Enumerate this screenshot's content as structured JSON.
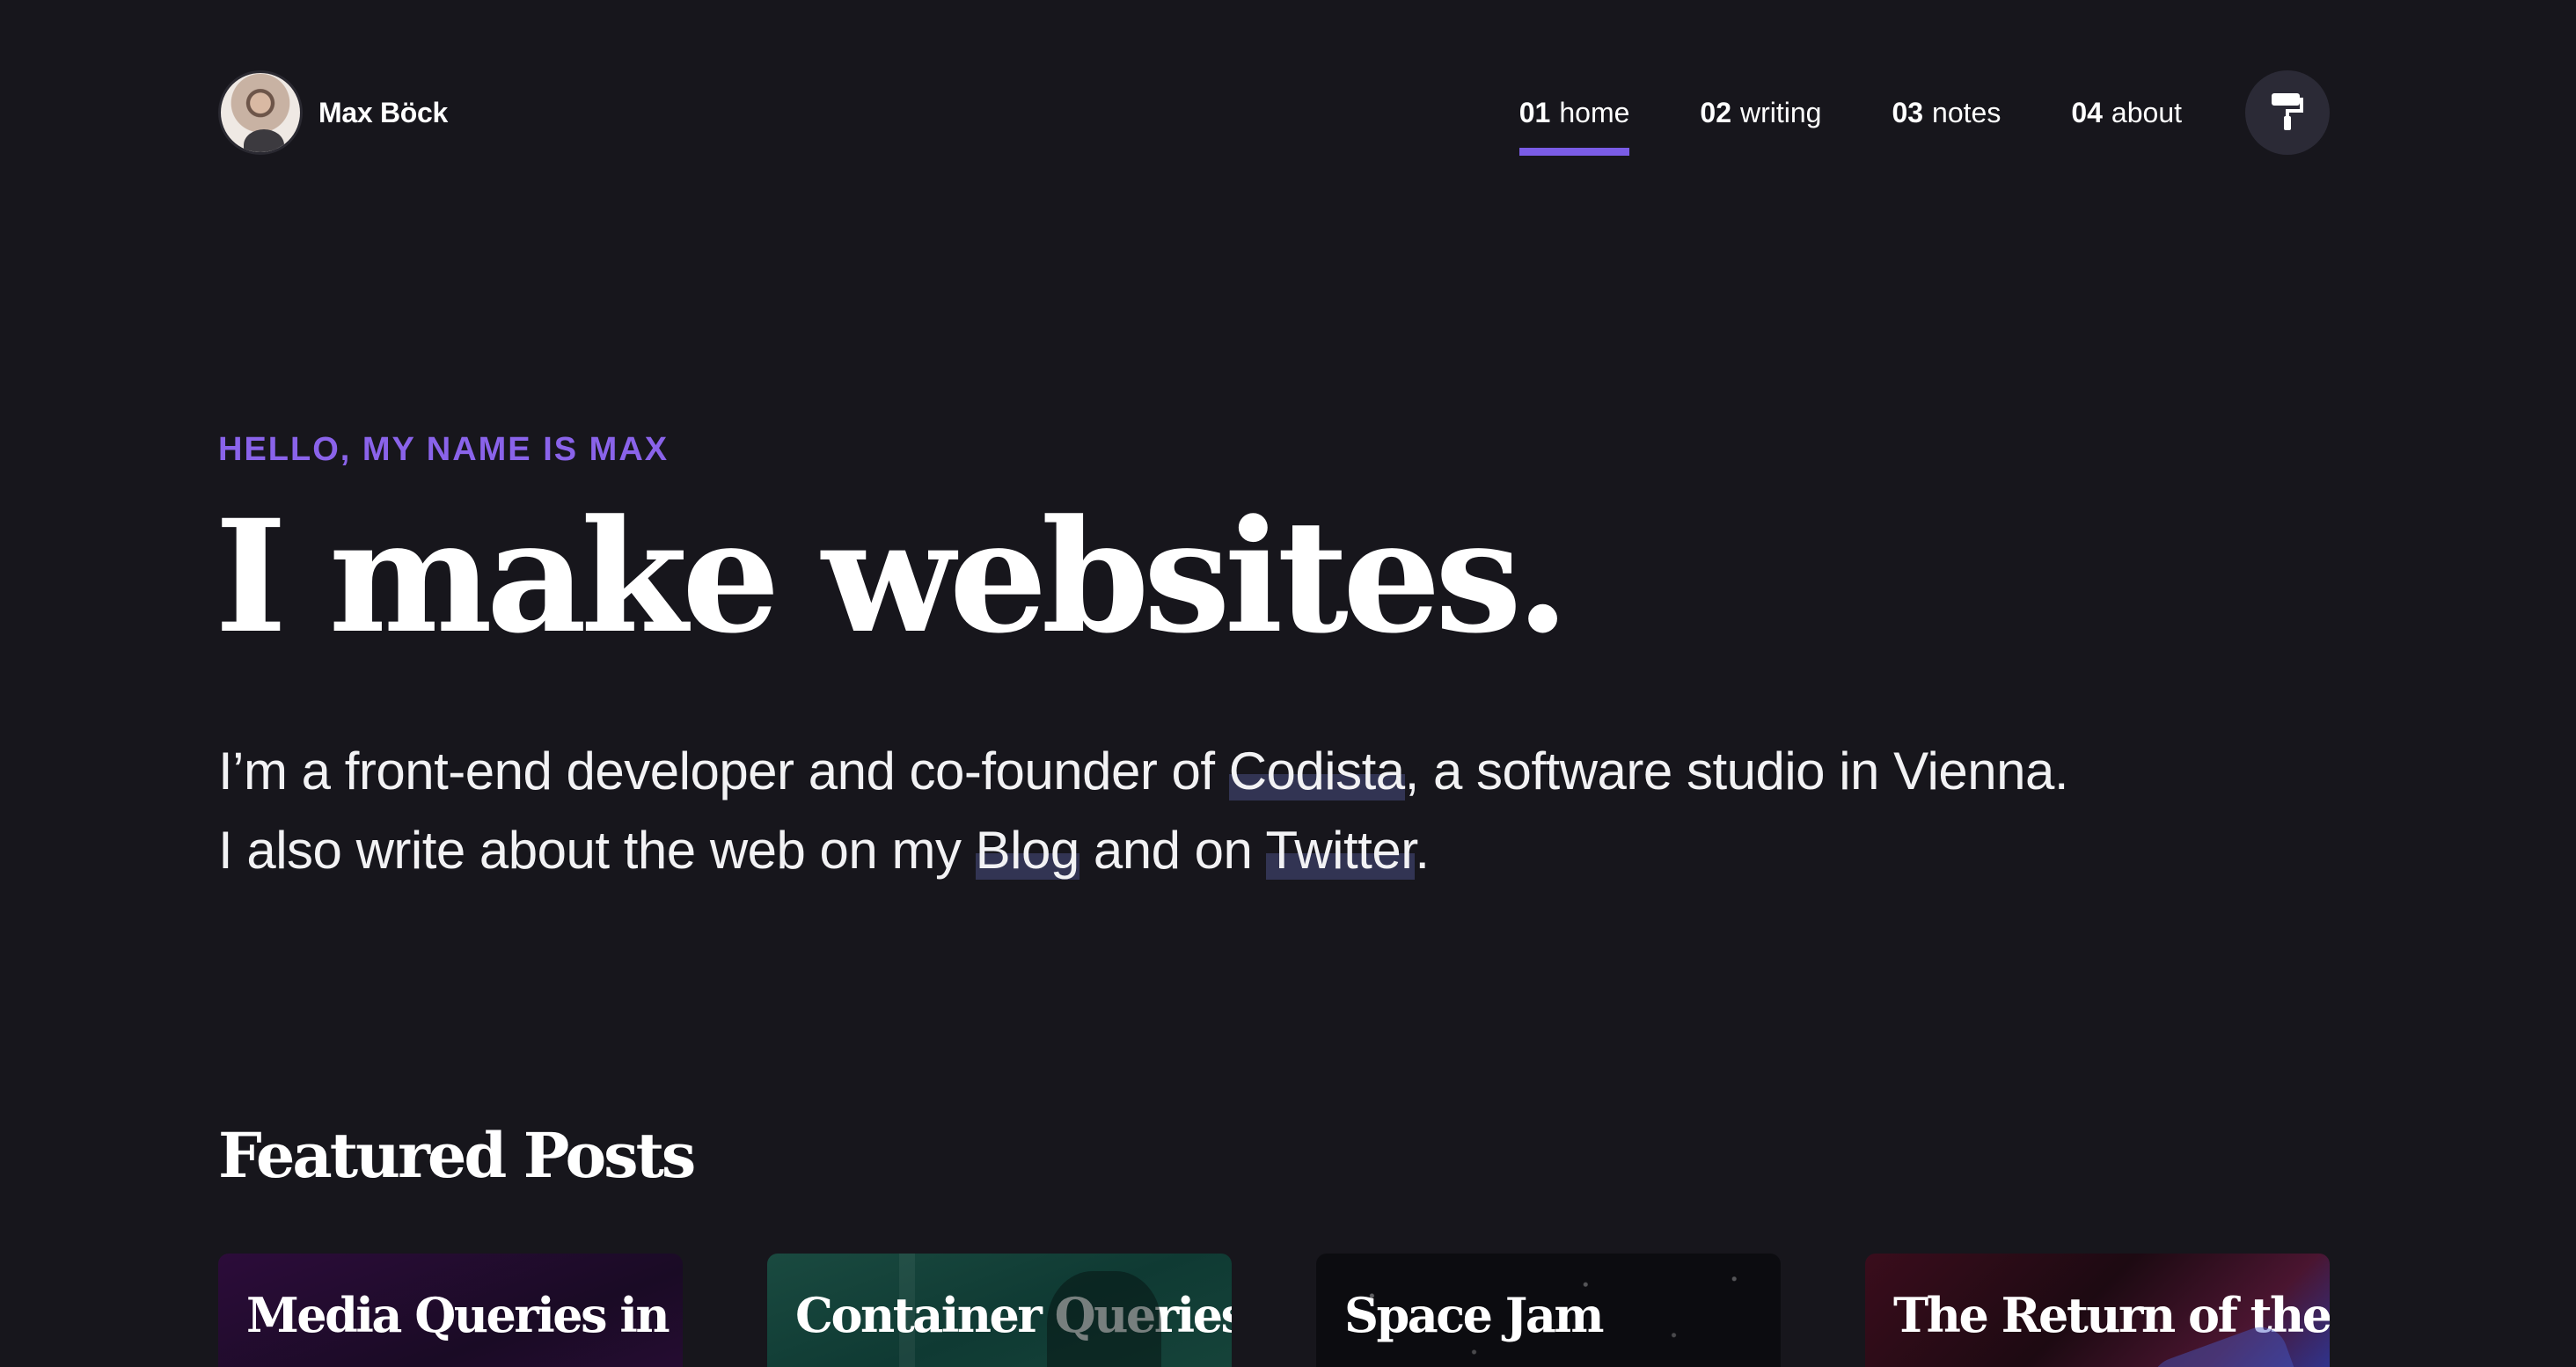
{
  "header": {
    "brand_name": "Max Böck",
    "nav": [
      {
        "num": "01",
        "label": "home",
        "active": true
      },
      {
        "num": "02",
        "label": "writing",
        "active": false
      },
      {
        "num": "03",
        "label": "notes",
        "active": false
      },
      {
        "num": "04",
        "label": "about",
        "active": false
      }
    ],
    "theme_button_icon": "paint-roller-icon"
  },
  "hero": {
    "eyebrow": "HELLO, MY NAME IS MAX",
    "title": "I make websites.",
    "line1_before": "I’m a front-end developer and co-founder of ",
    "link_codista": "Codista",
    "line1_after": ", a software studio in Vienna.",
    "line2_before": "I also write about the web on my ",
    "link_blog": "Blog",
    "line2_middle": " and on ",
    "link_twitter": "Twitter",
    "line2_after": "."
  },
  "featured": {
    "title": "Featured Posts",
    "cards": [
      {
        "title": "Media Queries in"
      },
      {
        "title": "Container Queries"
      },
      {
        "title": "Space Jam"
      },
      {
        "title": "The Return of the"
      }
    ]
  },
  "colors": {
    "background": "#17161c",
    "accent": "#7a5ce6",
    "eyebrow": "#8a63ea",
    "link_highlight": "#323453"
  }
}
